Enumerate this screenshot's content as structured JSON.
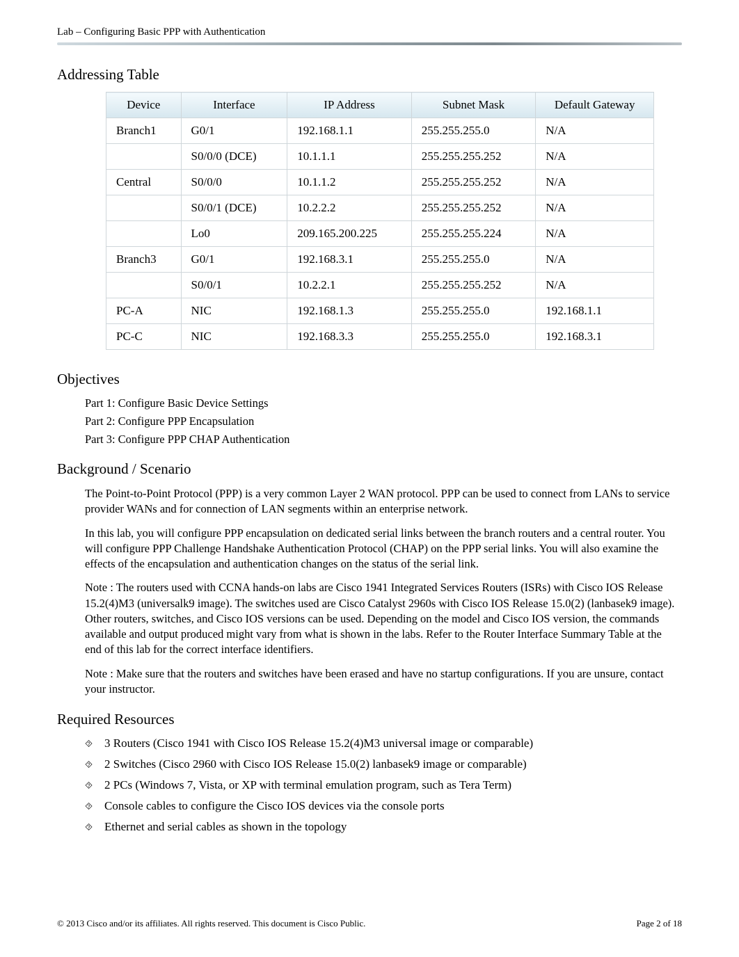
{
  "header": {
    "title": "Lab – Configuring Basic PPP with Authentication"
  },
  "sections": {
    "addressing_title": "Addressing Table",
    "objectives_title": "Objectives",
    "background_title": "Background / Scenario",
    "resources_title": "Required Resources"
  },
  "table": {
    "headers": [
      "Device",
      "Interface",
      "IP Address",
      "Subnet Mask",
      "Default Gateway"
    ],
    "rows": [
      [
        "Branch1",
        "G0/1",
        "192.168.1.1",
        "255.255.255.0",
        "N/A"
      ],
      [
        "",
        "S0/0/0 (DCE)",
        "10.1.1.1",
        "255.255.255.252",
        "N/A"
      ],
      [
        "Central",
        "S0/0/0",
        "10.1.1.2",
        "255.255.255.252",
        "N/A"
      ],
      [
        "",
        "S0/0/1 (DCE)",
        "10.2.2.2",
        "255.255.255.252",
        "N/A"
      ],
      [
        "",
        "Lo0",
        "209.165.200.225",
        "255.255.255.224",
        "N/A"
      ],
      [
        "Branch3",
        "G0/1",
        "192.168.3.1",
        "255.255.255.0",
        "N/A"
      ],
      [
        "",
        "S0/0/1",
        "10.2.2.1",
        "255.255.255.252",
        "N/A"
      ],
      [
        "PC-A",
        "NIC",
        "192.168.1.3",
        "255.255.255.0",
        "192.168.1.1"
      ],
      [
        "PC-C",
        "NIC",
        "192.168.3.3",
        "255.255.255.0",
        "192.168.3.1"
      ]
    ]
  },
  "objectives": {
    "items": [
      "Part 1: Configure Basic Device Settings",
      "Part 2: Configure PPP Encapsulation",
      "Part 3: Configure PPP CHAP Authentication"
    ]
  },
  "background": {
    "p1": "The Point-to-Point Protocol (PPP) is a very common Layer 2 WAN protocol. PPP can be used to connect from LANs to service provider WANs and for connection of LAN segments within an enterprise network.",
    "p2": "In this lab, you will configure PPP encapsulation on dedicated serial links between the branch routers and a central router. You will configure PPP Challenge Handshake Authentication Protocol (CHAP) on the PPP serial links. You will also examine the effects of the encapsulation and authentication changes on the status of the serial link.",
    "p3": "Note : The routers used with CCNA hands-on labs are Cisco 1941 Integrated Services Routers (ISRs) with Cisco IOS Release 15.2(4)M3 (universalk9 image). The switches used are Cisco Catalyst 2960s with Cisco IOS Release 15.0(2) (lanbasek9 image). Other routers, switches, and Cisco IOS versions can be used. Depending on the model and Cisco IOS version, the commands available and output produced might vary from what is shown in the labs. Refer to the Router Interface Summary Table at the end of this lab for the correct interface identifiers.",
    "p4": "Note : Make sure that the routers and switches have been erased and have no startup configurations. If you are unsure, contact your instructor."
  },
  "resources": {
    "items": [
      "3 Routers (Cisco 1941 with Cisco IOS Release 15.2(4)M3 universal image or comparable)",
      "2 Switches (Cisco 2960 with Cisco IOS Release 15.0(2) lanbasek9 image or comparable)",
      "2 PCs (Windows 7, Vista, or XP with terminal emulation program, such as Tera Term)",
      "Console cables to configure the Cisco IOS devices via the console ports",
      "Ethernet and serial cables as shown in the topology"
    ]
  },
  "footer": {
    "copyright": "© 2013 Cisco and/or its affiliates. All rights reserved. This document is Cisco Public.",
    "page": "Page  2 of 18"
  },
  "bullet_glyph": "⯑"
}
